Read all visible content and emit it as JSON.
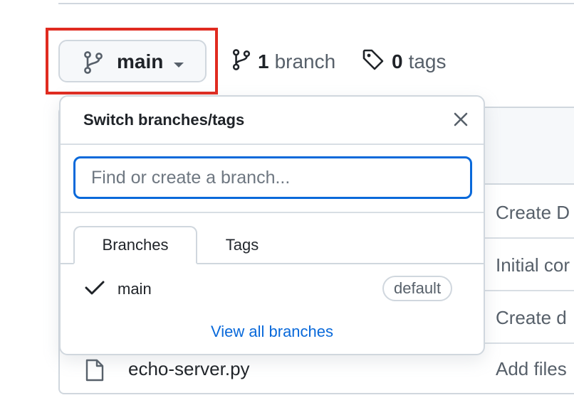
{
  "branch_button": {
    "label": "main"
  },
  "branches_link": {
    "count": "1",
    "label": "branch"
  },
  "tags_link": {
    "count": "0",
    "label": "tags"
  },
  "dropdown": {
    "title": "Switch branches/tags",
    "search": {
      "placeholder": "Find or create a branch...",
      "value": ""
    },
    "tabs": [
      {
        "label": "Branches",
        "active": true
      },
      {
        "label": "Tags",
        "active": false
      }
    ],
    "branches": [
      {
        "name": "main",
        "checked": true,
        "badge": "default"
      }
    ],
    "footer_link": "View all branches"
  },
  "files": {
    "rows": [
      {
        "commit_message": "Create D"
      },
      {
        "commit_message": "Initial cor"
      },
      {
        "commit_message": "Create d"
      },
      {
        "name": "echo-server.py",
        "commit_message": "Add files"
      }
    ]
  },
  "colors": {
    "highlight": "#e02b20",
    "link": "#0969da",
    "border": "#d0d7de",
    "muted_text": "#57606a"
  }
}
